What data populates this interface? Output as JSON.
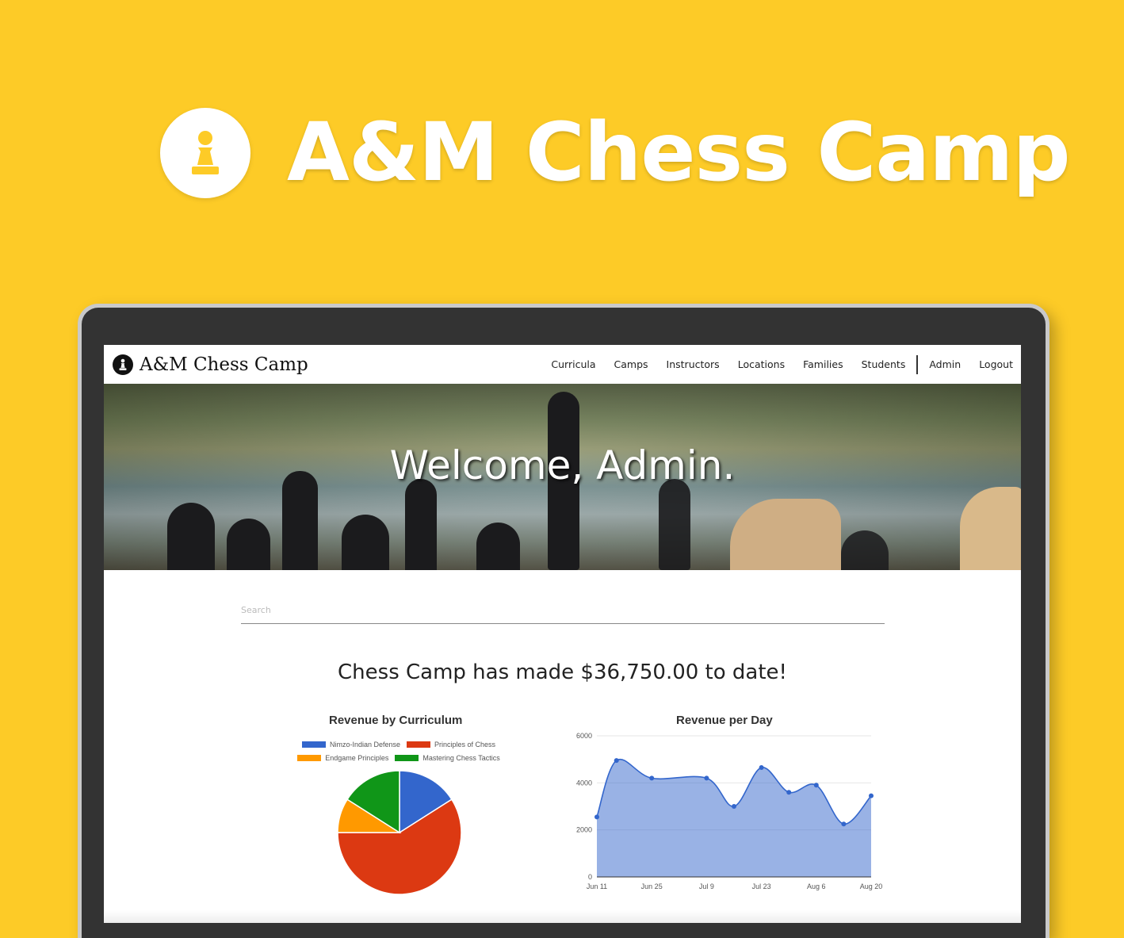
{
  "banner": {
    "title": "A&M Chess Camp",
    "logo_icon": "pawn-icon"
  },
  "navbar": {
    "brand": "A&M Chess Camp",
    "links": [
      "Curricula",
      "Camps",
      "Instructors",
      "Locations",
      "Families",
      "Students"
    ],
    "admin_links": [
      "Admin",
      "Logout"
    ]
  },
  "hero": {
    "title": "Welcome, Admin."
  },
  "search": {
    "placeholder": "Search",
    "value": ""
  },
  "revenue": {
    "total_text": "Chess Camp has made $36,750.00 to date!"
  },
  "colors": {
    "brand_yellow": "#FDCB27",
    "nimzo": "#3366CC",
    "principles": "#DC3912",
    "endgame": "#FF9900",
    "tactics": "#109618"
  },
  "chart_data": [
    {
      "type": "pie",
      "title": "Revenue by Curriculum",
      "legend_position": "top",
      "categories": [
        "Nimzo-Indian Defense",
        "Principles of Chess",
        "Endgame Principles",
        "Mastering Chess Tactics"
      ],
      "values": [
        16,
        59,
        9,
        16
      ],
      "colors": [
        "#3366CC",
        "#DC3912",
        "#FF9900",
        "#109618"
      ]
    },
    {
      "type": "area",
      "title": "Revenue per Day",
      "x_tick_labels": [
        "Jun 11",
        "Jun 25",
        "Jul 9",
        "Jul 23",
        "Aug 6",
        "Aug 20"
      ],
      "y_tick_labels": [
        "0",
        "2000",
        "4000",
        "6000"
      ],
      "ylim": [
        0,
        6000
      ],
      "grid": true,
      "color": "#3366CC",
      "x": [
        "Jun 11",
        "Jun 16",
        "Jun 25",
        "Jul 9",
        "Jul 16",
        "Jul 23",
        "Jul 30",
        "Aug 6",
        "Aug 13",
        "Aug 20"
      ],
      "values": [
        2550,
        4950,
        4200,
        4200,
        3000,
        4650,
        3600,
        3900,
        2250,
        3450
      ]
    }
  ]
}
